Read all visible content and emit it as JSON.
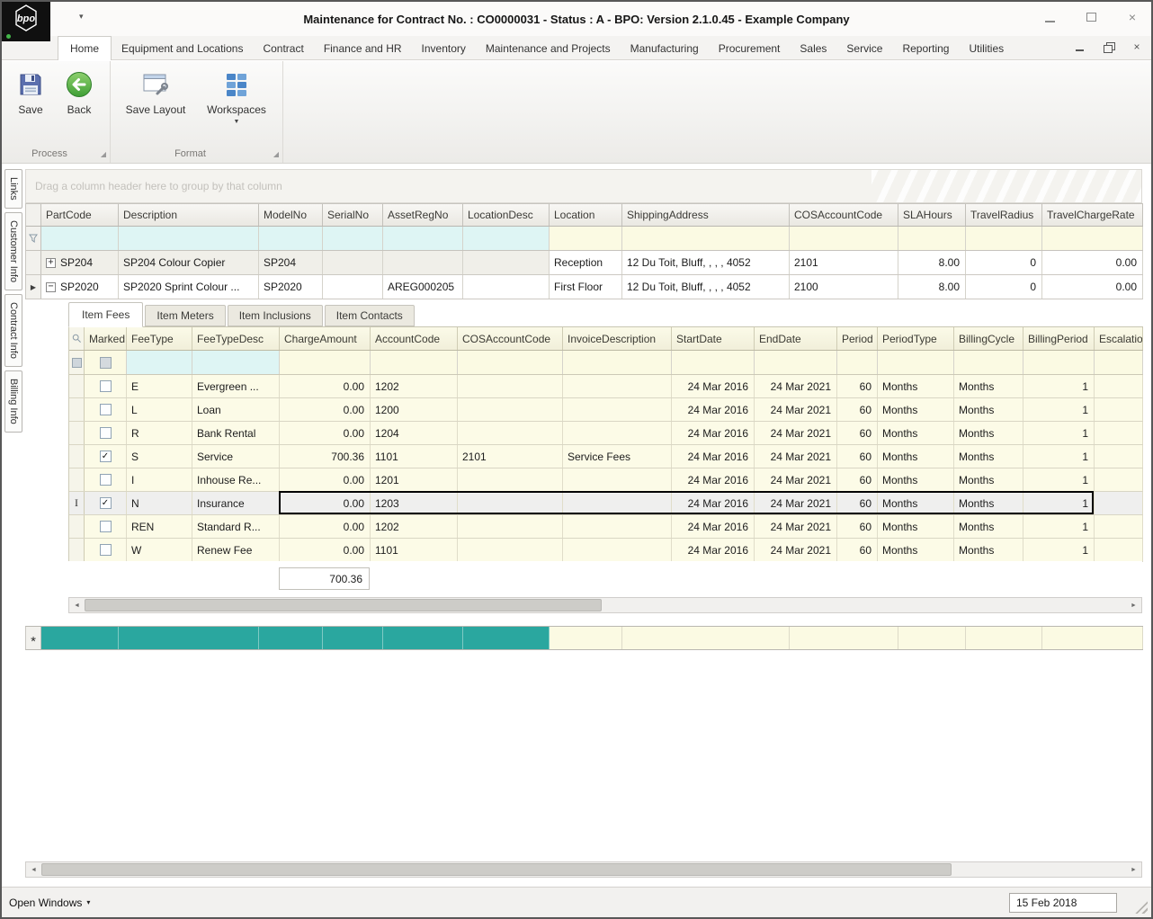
{
  "titlebar": {
    "logo": "bpo",
    "title": "Maintenance for Contract No. : CO0000031 - Status : A - BPO: Version 2.1.0.45 - Example Company"
  },
  "icons": {
    "qat_dropdown": "▾",
    "close": "×",
    "dropdown": "▼",
    "statusbar_chevron": "▾",
    "scroll_left": "◄",
    "scroll_right": "►",
    "row_arrow": "▶",
    "new_row_asterisk": "*",
    "ibeam": "I",
    "expand_plus": "+",
    "collapse_minus": "−",
    "checkmark": "✓"
  },
  "ribbon": {
    "tabs": [
      {
        "label": "Home",
        "active": true
      },
      {
        "label": "Equipment and Locations"
      },
      {
        "label": "Contract"
      },
      {
        "label": "Finance and HR"
      },
      {
        "label": "Inventory"
      },
      {
        "label": "Maintenance and Projects"
      },
      {
        "label": "Manufacturing"
      },
      {
        "label": "Procurement"
      },
      {
        "label": "Sales"
      },
      {
        "label": "Service"
      },
      {
        "label": "Reporting"
      },
      {
        "label": "Utilities"
      }
    ],
    "buttons": {
      "save": "Save",
      "back": "Back",
      "save_layout": "Save Layout",
      "workspaces": "Workspaces"
    },
    "groups": {
      "process": "Process",
      "format": "Format"
    }
  },
  "sidebar": {
    "tabs": [
      "Links",
      "Customer Info",
      "Contract Info",
      "Billing Info"
    ]
  },
  "group_by_hint": "Drag a column header here to group by that column",
  "master_grid": {
    "columns": [
      "PartCode",
      "Description",
      "ModelNo",
      "SerialNo",
      "AssetRegNo",
      "LocationDesc",
      "Location",
      "ShippingAddress",
      "COSAccountCode",
      "SLAHours",
      "TravelRadius",
      "TravelChargeRate"
    ],
    "rows": [
      {
        "expander": "plus",
        "selected": false,
        "cells": [
          "SP204",
          "SP204 Colour Copier",
          "SP204",
          "",
          "",
          "",
          "Reception",
          "12 Du Toit, Bluff, , , , 4052",
          "2101",
          "8.00",
          "0",
          "0.00"
        ]
      },
      {
        "expander": "minus",
        "selected": true,
        "cells": [
          "SP2020",
          "SP2020 Sprint Colour ...",
          "SP2020",
          "",
          "AREG000205",
          "",
          "First Floor",
          "12 Du Toit, Bluff, , , , 4052",
          "2100",
          "8.00",
          "0",
          "0.00"
        ]
      }
    ]
  },
  "detail_tabs": [
    {
      "label": "Item Fees",
      "active": true
    },
    {
      "label": "Item Meters"
    },
    {
      "label": "Item Inclusions"
    },
    {
      "label": "Item Contacts"
    }
  ],
  "detail_grid": {
    "columns": [
      "Marked",
      "FeeType",
      "FeeTypeDesc",
      "ChargeAmount",
      "AccountCode",
      "COSAccountCode",
      "InvoiceDescription",
      "StartDate",
      "EndDate",
      "Period",
      "PeriodType",
      "BillingCycle",
      "BillingPeriod",
      "Escalation"
    ],
    "rows": [
      {
        "marked": false,
        "selected": false,
        "cells": [
          "E",
          "Evergreen ...",
          "0.00",
          "1202",
          "",
          "",
          "24 Mar 2016",
          "24 Mar 2021",
          "60",
          "Months",
          "Months",
          "1",
          ""
        ]
      },
      {
        "marked": false,
        "selected": false,
        "cells": [
          "L",
          "Loan",
          "0.00",
          "1200",
          "",
          "",
          "24 Mar 2016",
          "24 Mar 2021",
          "60",
          "Months",
          "Months",
          "1",
          ""
        ]
      },
      {
        "marked": false,
        "selected": false,
        "cells": [
          "R",
          "Bank Rental",
          "0.00",
          "1204",
          "",
          "",
          "24 Mar 2016",
          "24 Mar 2021",
          "60",
          "Months",
          "Months",
          "1",
          ""
        ]
      },
      {
        "marked": true,
        "selected": false,
        "cells": [
          "S",
          "Service",
          "700.36",
          "1101",
          "2101",
          "Service Fees",
          "24 Mar 2016",
          "24 Mar 2021",
          "60",
          "Months",
          "Months",
          "1",
          ""
        ]
      },
      {
        "marked": false,
        "selected": false,
        "cells": [
          "I",
          "Inhouse Re...",
          "0.00",
          "1201",
          "",
          "",
          "24 Mar 2016",
          "24 Mar 2021",
          "60",
          "Months",
          "Months",
          "1",
          ""
        ]
      },
      {
        "marked": true,
        "selected": true,
        "cells": [
          "N",
          "Insurance",
          "0.00",
          "1203",
          "",
          "",
          "24 Mar 2016",
          "24 Mar 2021",
          "60",
          "Months",
          "Months",
          "1",
          ""
        ]
      },
      {
        "marked": false,
        "selected": false,
        "cells": [
          "REN",
          "Standard R...",
          "0.00",
          "1202",
          "",
          "",
          "24 Mar 2016",
          "24 Mar 2021",
          "60",
          "Months",
          "Months",
          "1",
          ""
        ]
      },
      {
        "marked": false,
        "selected": false,
        "cells": [
          "W",
          "Renew Fee",
          "0.00",
          "1101",
          "",
          "",
          "24 Mar 2016",
          "24 Mar 2021",
          "60",
          "Months",
          "Months",
          "1",
          ""
        ]
      }
    ],
    "summary_charge_amount": "700.36"
  },
  "statusbar": {
    "open_windows": "Open Windows",
    "date": "15 Feb 2018"
  }
}
